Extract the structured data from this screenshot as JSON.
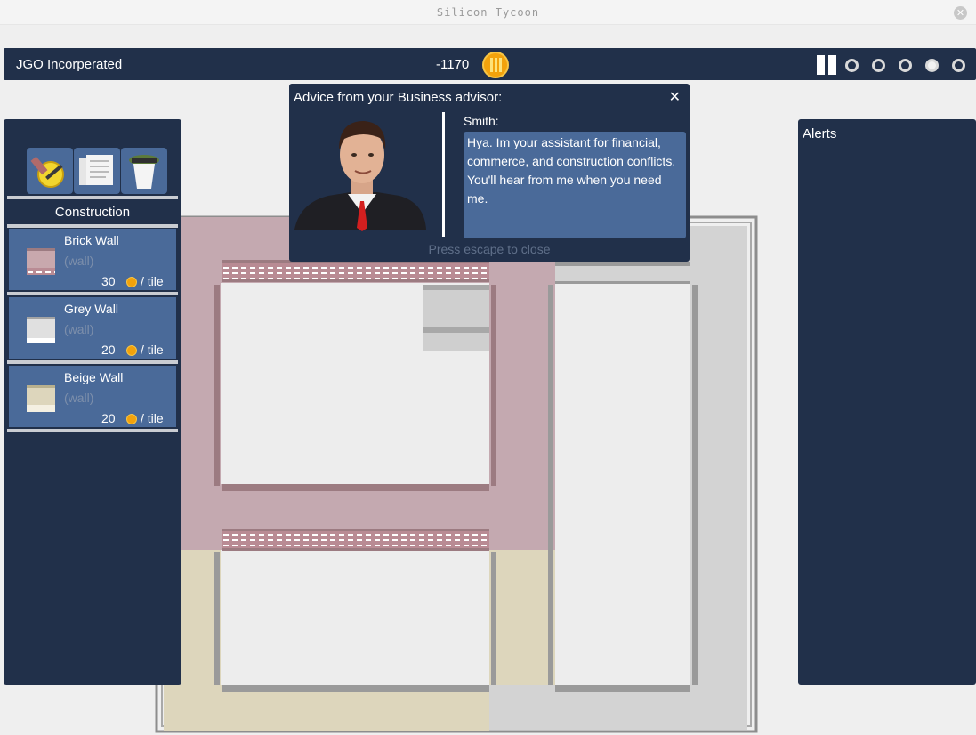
{
  "window": {
    "title": "Silicon Tycoon"
  },
  "topbar": {
    "company": "JGO Incorperated",
    "money": "-1170",
    "speeds": [
      false,
      false,
      false,
      true,
      false
    ]
  },
  "build_panel": {
    "categories": [
      {
        "icon": "construction-tools-icon"
      },
      {
        "icon": "documents-icon"
      },
      {
        "icon": "plant-pot-icon"
      }
    ],
    "section_title": "Construction",
    "items": [
      {
        "name": "Brick Wall",
        "kind": "(wall)",
        "price": "30",
        "unit": "/ tile",
        "color": "#c8a8ad"
      },
      {
        "name": "Grey Wall",
        "kind": "(wall)",
        "price": "20",
        "unit": "/ tile",
        "color": "#d2d2d2"
      },
      {
        "name": "Beige Wall",
        "kind": "(wall)",
        "price": "20",
        "unit": "/ tile",
        "color": "#ddd6bc"
      }
    ]
  },
  "alerts": {
    "title": "Alerts"
  },
  "dialog": {
    "header": "Advice from your Business advisor:",
    "close_glyph": "✕",
    "speaker": "Smith:",
    "message": "Hya. Im your assistant for financial, commerce, and construction conflicts. You'll hear from me when you need me.",
    "hint": "Press escape to close"
  },
  "colors": {
    "panel": "#21304a",
    "item": "#4a6a99",
    "coin": "#f2a20c",
    "brick_floor": "#c4a9b0",
    "beige_floor": "#ddd6bc",
    "grey_floor": "#d3d3d3"
  }
}
